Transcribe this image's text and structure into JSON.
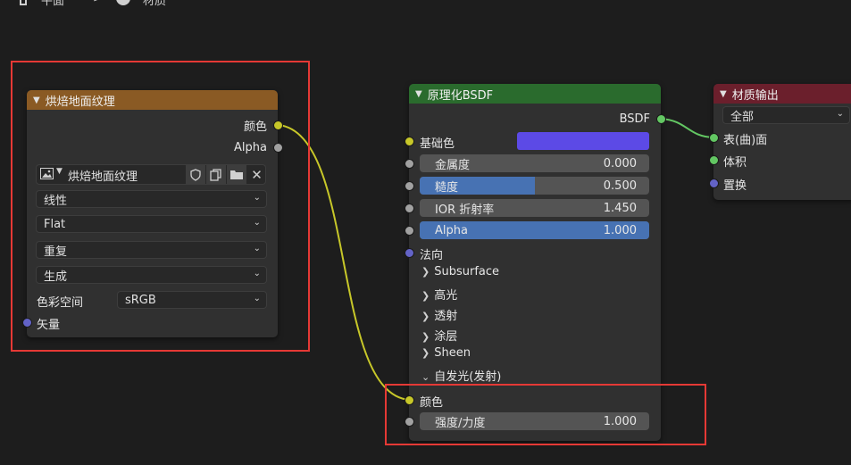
{
  "topbar": {
    "item1": "平面",
    "separator": ">",
    "item2": "材质"
  },
  "image_node": {
    "title": "烘焙地面纹理",
    "header_color": "#8a5a24",
    "outputs": [
      "颜色",
      "Alpha"
    ],
    "image_name": "烘焙地面纹理",
    "interpolation": "线性",
    "projection": "Flat",
    "extension": "重复",
    "source": "生成",
    "colorspace_label": "色彩空间",
    "colorspace_value": "sRGB",
    "vector_input": "矢量",
    "icons": [
      "image-icon",
      "shield-icon",
      "duplicate-icon",
      "folder-icon",
      "close-icon"
    ]
  },
  "bsdf_node": {
    "title": "原理化BSDF",
    "header_color": "#2a6b2d",
    "output": "BSDF",
    "base_color_label": "基础色",
    "base_color_value": "#5c4ae6",
    "fields": [
      {
        "label": "金属度",
        "value": "0.000",
        "fill": 0.0
      },
      {
        "label": "糙度",
        "value": "0.500",
        "fill": 0.5
      },
      {
        "label": "IOR 折射率",
        "value": "1.450",
        "fill": 0.0
      },
      {
        "label": "Alpha",
        "value": "1.000",
        "fill": 1.0
      }
    ],
    "normal_label": "法向",
    "panels": [
      "Subsurface",
      "高光",
      "透射",
      "涂层",
      "Sheen"
    ],
    "emission_panel": "自发光(发射)",
    "emission_color_label": "颜色",
    "emission_strength": {
      "label": "强度/力度",
      "value": "1.000"
    }
  },
  "output_node": {
    "title": "材质输出",
    "header_color": "#6b1f2c",
    "target": "全部",
    "inputs": [
      "表(曲)面",
      "体积",
      "置换"
    ]
  },
  "colors": {
    "background": "#1d1d1d",
    "highlight_box": "#e53935",
    "link_color": "#c7c729",
    "link_shader": "#63c763"
  }
}
